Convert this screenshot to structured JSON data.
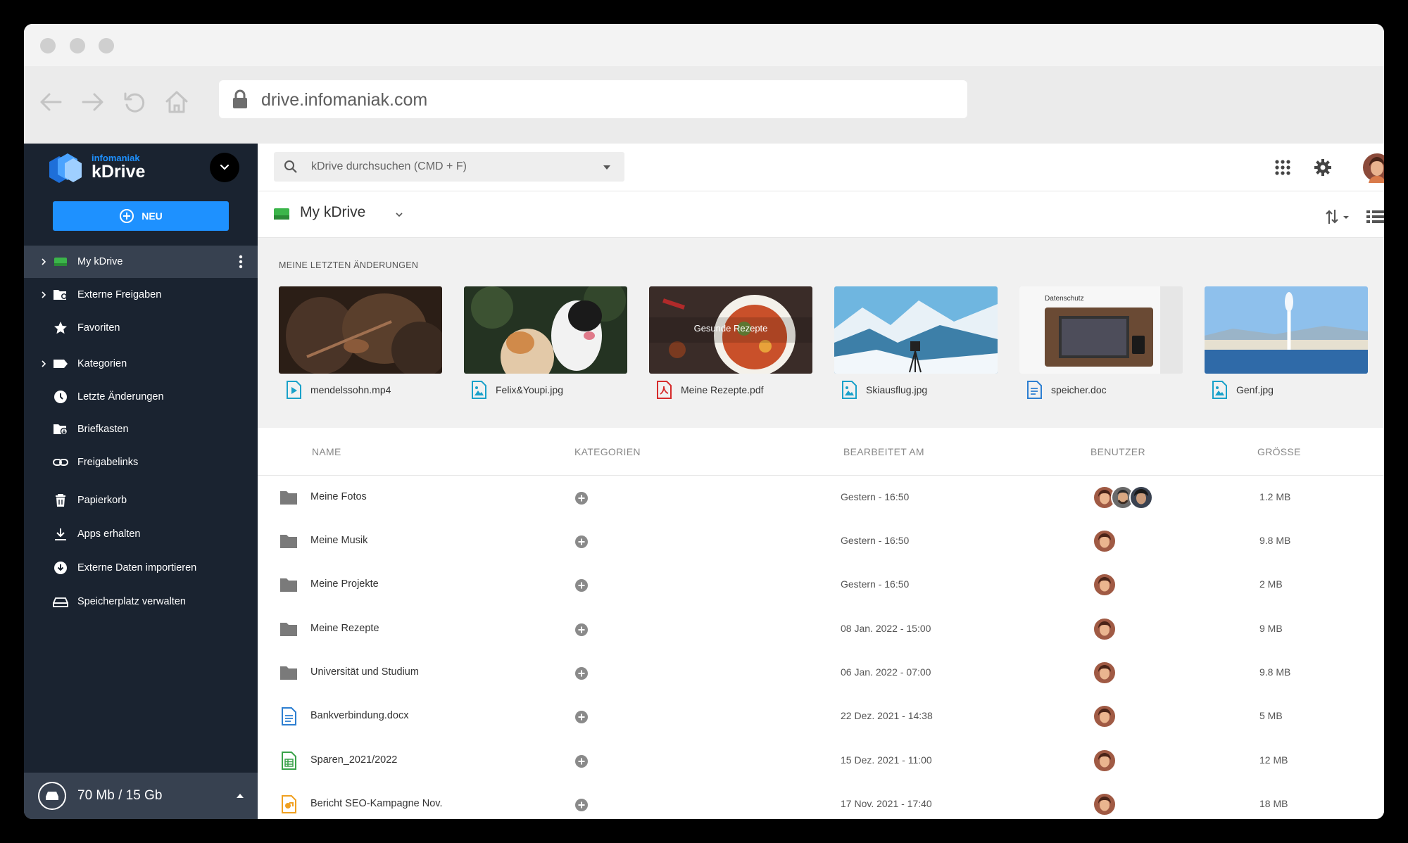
{
  "browser": {
    "url": "drive.infomaniak.com"
  },
  "app": {
    "brand_small": "infomaniak",
    "brand_name": "kDrive",
    "new_button": "NEU",
    "accent_color": "#1e91ff",
    "sidebar_color": "#1a2330"
  },
  "sidebar": {
    "items": [
      {
        "label": "My kDrive",
        "icon": "drive-icon",
        "expandable": true,
        "active": true
      },
      {
        "label": "Externe Freigaben",
        "icon": "shared-folder-icon",
        "expandable": true
      },
      {
        "label": "Favoriten",
        "icon": "star-icon"
      },
      {
        "label": "Kategorien",
        "icon": "tag-icon",
        "expandable": true
      },
      {
        "label": "Letzte Änderungen",
        "icon": "clock-icon"
      },
      {
        "label": "Briefkasten",
        "icon": "dropbox-folder-icon"
      },
      {
        "label": "Freigabelinks",
        "icon": "link-icon"
      },
      {
        "label": "Papierkorb",
        "icon": "trash-icon"
      },
      {
        "label": "Apps erhalten",
        "icon": "download-icon"
      },
      {
        "label": "Externe Daten importieren",
        "icon": "import-icon"
      },
      {
        "label": "Speicherplatz verwalten",
        "icon": "storage-icon"
      }
    ],
    "storage": "70 Mb / 15 Gb"
  },
  "search": {
    "placeholder": "kDrive durchsuchen (CMD + F)"
  },
  "breadcrumb": {
    "title": "My kDrive"
  },
  "recent": {
    "title": "MEINE LETZTEN ÄNDERUNGEN",
    "items": [
      {
        "name": "mendelssohn.mp4",
        "type": "video",
        "icon_color": "#1aa1c9"
      },
      {
        "name": "Felix&Youpi.jpg",
        "type": "image",
        "icon_color": "#1aa1c9"
      },
      {
        "name": "Meine Rezepte.pdf",
        "type": "pdf",
        "icon_color": "#d62b2b",
        "overlay": "Gesunde Rezepte"
      },
      {
        "name": "Skiausflug.jpg",
        "type": "image",
        "icon_color": "#1aa1c9"
      },
      {
        "name": "speicher.doc",
        "type": "doc",
        "icon_color": "#2d7fd1",
        "overlay": "Datenschutz"
      },
      {
        "name": "Genf.jpg",
        "type": "image",
        "icon_color": "#1aa1c9"
      }
    ]
  },
  "table": {
    "headers": {
      "name": "NAME",
      "categories": "KATEGORIEN",
      "edited": "BEARBEITET AM",
      "users": "BENUTZER",
      "size": "GRÖSSE"
    },
    "rows": [
      {
        "name": "Meine Fotos",
        "type": "folder",
        "edited": "Gestern - 16:50",
        "users": 3,
        "size": "1.2 MB"
      },
      {
        "name": "Meine Musik",
        "type": "folder",
        "edited": "Gestern - 16:50",
        "users": 1,
        "size": "9.8 MB"
      },
      {
        "name": "Meine Projekte",
        "type": "folder",
        "edited": "Gestern - 16:50",
        "users": 1,
        "size": "2 MB"
      },
      {
        "name": "Meine Rezepte",
        "type": "folder",
        "edited": "08 Jan. 2022 - 15:00",
        "users": 1,
        "size": "9 MB"
      },
      {
        "name": "Universität und Studium",
        "type": "folder",
        "edited": "06 Jan. 2022 - 07:00",
        "users": 1,
        "size": "9.8 MB"
      },
      {
        "name": "Bankverbindung.docx",
        "type": "doc",
        "edited": "22 Dez. 2021 - 14:38",
        "users": 1,
        "size": "5 MB"
      },
      {
        "name": "Sparen_2021/2022",
        "type": "sheet",
        "edited": "15 Dez. 2021 - 11:00",
        "users": 1,
        "size": "12 MB"
      },
      {
        "name": "Bericht SEO-Kampagne Nov.",
        "type": "slides",
        "edited": "17 Nov. 2021 - 17:40",
        "users": 1,
        "size": "18 MB"
      }
    ]
  }
}
